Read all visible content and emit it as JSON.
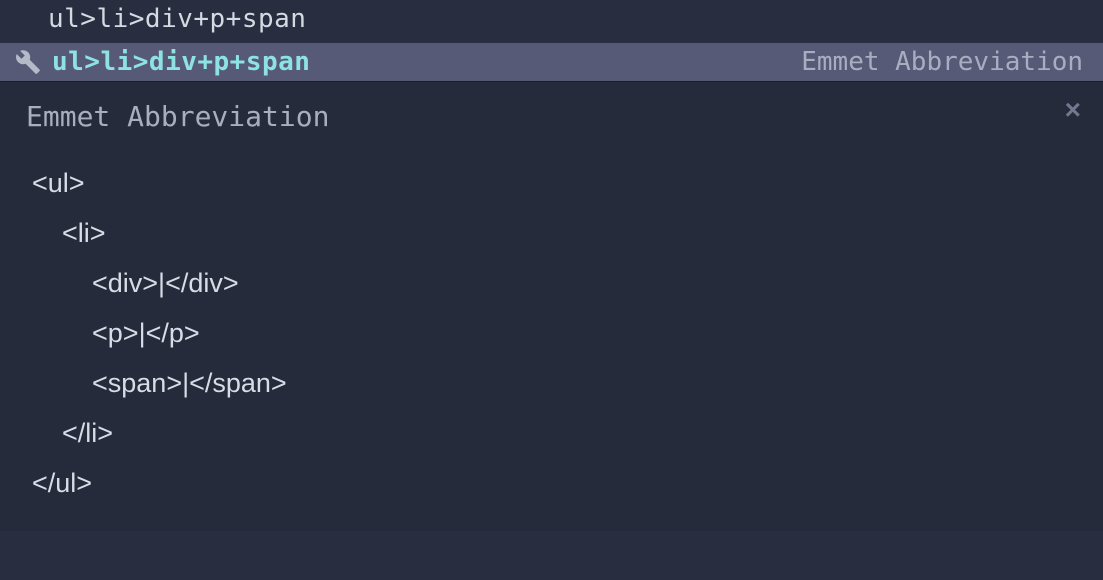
{
  "editor": {
    "input_text": "ul>li>div+p+span"
  },
  "suggestion": {
    "abbreviation": "ul>li>div+p+span",
    "type_label": "Emmet Abbreviation"
  },
  "preview": {
    "title": "Emmet Abbreviation",
    "code": "<ul>\n    <li>\n        <div>|</div>\n        <p>|</p>\n        <span>|</span>\n    </li>\n</ul>"
  },
  "icons": {
    "wrench": "wrench-icon",
    "close": "×"
  }
}
